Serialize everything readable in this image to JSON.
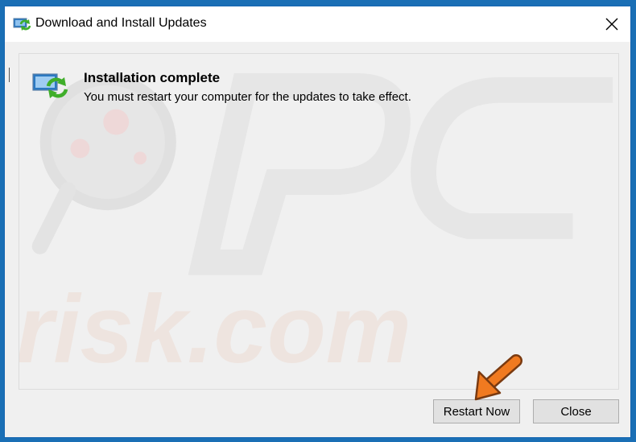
{
  "window": {
    "title": "Download and Install Updates"
  },
  "status": {
    "heading": "Installation complete",
    "message": "You must restart your computer for the updates to take effect."
  },
  "buttons": {
    "restart_label": "Restart Now",
    "close_label": "Close"
  },
  "icons": {
    "title_icon": "windows-update-icon",
    "status_icon": "windows-update-icon",
    "close": "close-icon",
    "pointer": "orange-arrow-pointer"
  },
  "watermark": {
    "text": "risk.com"
  },
  "colors": {
    "desktop_border": "#1a6fb5",
    "dialog_bg": "#f0f0f0",
    "button_bg": "#e1e1e1",
    "arrow": "#f07a20",
    "update_green": "#3fae2a",
    "monitor_blue": "#2b79c2"
  }
}
